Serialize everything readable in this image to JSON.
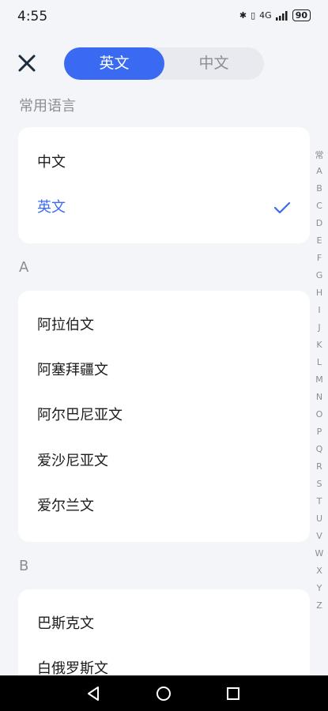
{
  "status": {
    "time": "4:55",
    "network": "4G",
    "battery": "90"
  },
  "header": {
    "close_icon": "close-icon",
    "tabs": [
      {
        "label": "英文",
        "active": true
      },
      {
        "label": "中文",
        "active": false
      }
    ]
  },
  "sections": [
    {
      "title": "常用语言",
      "items": [
        {
          "label": "中文",
          "selected": false
        },
        {
          "label": "英文",
          "selected": true
        }
      ]
    },
    {
      "title": "A",
      "items": [
        {
          "label": "阿拉伯文"
        },
        {
          "label": "阿塞拜疆文"
        },
        {
          "label": "阿尔巴尼亚文"
        },
        {
          "label": "爱沙尼亚文"
        },
        {
          "label": "爱尔兰文"
        }
      ]
    },
    {
      "title": "B",
      "items": [
        {
          "label": "巴斯克文"
        },
        {
          "label": "白俄罗斯文"
        }
      ]
    }
  ],
  "index": [
    "常",
    "A",
    "B",
    "C",
    "D",
    "E",
    "F",
    "G",
    "H",
    "I",
    "J",
    "K",
    "L",
    "M",
    "N",
    "O",
    "P",
    "Q",
    "R",
    "S",
    "T",
    "U",
    "V",
    "W",
    "X",
    "Y",
    "Z"
  ],
  "accent_color": "#3a6af2"
}
